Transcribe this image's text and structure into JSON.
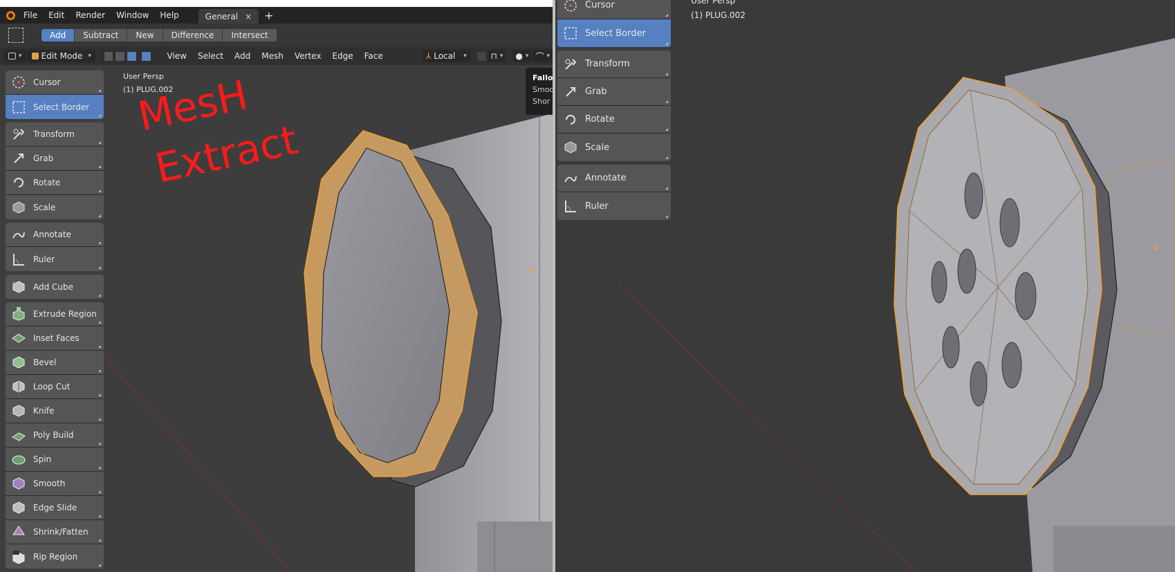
{
  "menubar": {
    "items": [
      "File",
      "Edit",
      "Render",
      "Window",
      "Help"
    ],
    "workspace_tab": "General",
    "close_glyph": "×",
    "add_glyph": "+"
  },
  "tool_header": {
    "modes": [
      "Add",
      "Subtract",
      "New",
      "Difference",
      "Intersect"
    ],
    "active_mode": "Add"
  },
  "viewport_header": {
    "mode": "Edit Mode",
    "menus": [
      "View",
      "Select",
      "Add",
      "Mesh",
      "Vertex",
      "Edge",
      "Face"
    ],
    "orientation": "Local"
  },
  "left_viewport": {
    "view_name": "User Persp",
    "object_name": "(1) PLUG.002",
    "annotation_line1": "MesH",
    "annotation_line2": "Extract",
    "annotation_color": "#ff1a1a",
    "falloff_popup": {
      "title": "Fallof",
      "item1": "Smoo",
      "item2": "Shor"
    }
  },
  "left_toolbar": {
    "groups": [
      [
        {
          "label": "Cursor",
          "icon": "cursor-icon"
        },
        {
          "label": "Select Border",
          "icon": "select-box-icon",
          "active": true
        }
      ],
      [
        {
          "label": "Transform",
          "icon": "transform-icon"
        },
        {
          "label": "Grab",
          "icon": "grab-icon"
        },
        {
          "label": "Rotate",
          "icon": "rotate-icon"
        },
        {
          "label": "Scale",
          "icon": "scale-icon"
        }
      ],
      [
        {
          "label": "Annotate",
          "icon": "annotate-icon"
        },
        {
          "label": "Ruler",
          "icon": "ruler-icon"
        }
      ],
      [
        {
          "label": "Add Cube",
          "icon": "add-cube-icon"
        }
      ],
      [
        {
          "label": "Extrude Region",
          "icon": "extrude-icon"
        },
        {
          "label": "Inset Faces",
          "icon": "inset-icon"
        },
        {
          "label": "Bevel",
          "icon": "bevel-icon"
        },
        {
          "label": "Loop Cut",
          "icon": "loop-cut-icon"
        },
        {
          "label": "Knife",
          "icon": "knife-icon"
        },
        {
          "label": "Poly Build",
          "icon": "poly-build-icon"
        },
        {
          "label": "Spin",
          "icon": "spin-icon"
        },
        {
          "label": "Smooth",
          "icon": "smooth-icon"
        },
        {
          "label": "Edge Slide",
          "icon": "edge-slide-icon"
        },
        {
          "label": "Shrink/Fatten",
          "icon": "shrink-fatten-icon"
        },
        {
          "label": "Rip Region",
          "icon": "rip-region-icon"
        }
      ]
    ]
  },
  "right_viewport": {
    "view_name": "User Persp",
    "object_name": "(1) PLUG.002"
  },
  "right_toolbar": {
    "groups": [
      [
        {
          "label": "Cursor",
          "icon": "cursor-icon"
        },
        {
          "label": "Select Border",
          "icon": "select-box-icon",
          "active": true
        }
      ],
      [
        {
          "label": "Transform",
          "icon": "transform-icon"
        },
        {
          "label": "Grab",
          "icon": "grab-icon"
        },
        {
          "label": "Rotate",
          "icon": "rotate-icon"
        },
        {
          "label": "Scale",
          "icon": "scale-icon"
        }
      ],
      [
        {
          "label": "Annotate",
          "icon": "annotate-icon"
        },
        {
          "label": "Ruler",
          "icon": "ruler-icon"
        }
      ]
    ]
  },
  "colors": {
    "accent": "#5680c2",
    "selection_orange": "#f0a030"
  }
}
